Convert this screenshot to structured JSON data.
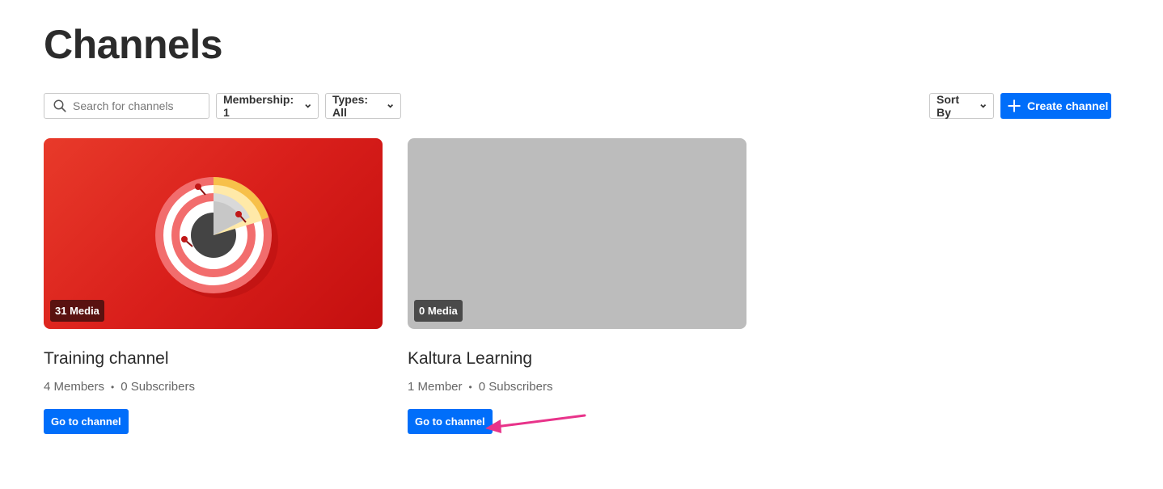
{
  "header": {
    "title": "Channels"
  },
  "toolbar": {
    "search_placeholder": "Search for channels",
    "membership_label": "Membership: 1",
    "types_label": "Types: All",
    "sort_label": "Sort By",
    "create_label": "Create channel"
  },
  "channels": [
    {
      "media_count": "31 Media",
      "title": "Training channel",
      "members": "4 Members",
      "subscribers": "0 Subscribers",
      "button": "Go to channel"
    },
    {
      "media_count": "0 Media",
      "title": "Kaltura Learning",
      "members": "1 Member",
      "subscribers": "0 Subscribers",
      "button": "Go to channel"
    }
  ],
  "icons": {
    "search": "search-icon",
    "chevron": "chevron-down-icon",
    "plus": "plus-icon"
  },
  "colors": {
    "accent": "#006efa",
    "annotation": "#e8338a",
    "thumb_red": "#d91f1b",
    "thumb_grey": "#bcbcbc"
  }
}
